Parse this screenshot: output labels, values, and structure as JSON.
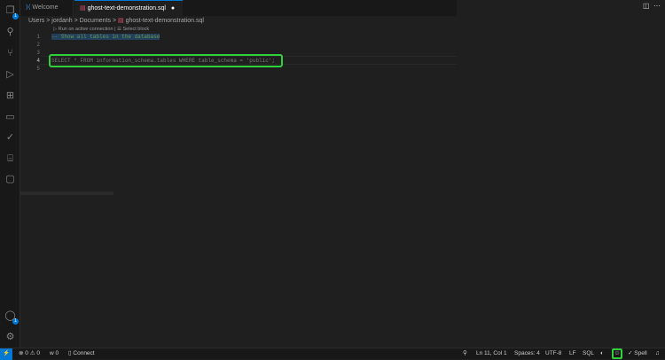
{
  "tabs": [
    {
      "label": "Welcome"
    },
    {
      "label": "ghost-text-demonstration.sql",
      "modified": "●"
    }
  ],
  "breadcrumb": [
    "Users",
    "jordanh",
    "Documents",
    "ghost-text-demonstration.sql"
  ],
  "codelens": {
    "run": "▷ Run on active connection",
    "sep": "|",
    "select": "☰ Select block"
  },
  "lines": [
    {
      "n": "1",
      "text": "-- Show all tables in the database"
    },
    {
      "n": "2",
      "text": ""
    },
    {
      "n": "3",
      "text": ""
    },
    {
      "n": "4",
      "text": "SELECT * FROM information_schema.tables WHERE table_schema = 'public';"
    },
    {
      "n": "5",
      "text": ""
    }
  ],
  "activity": {
    "explorer_badge": "1",
    "accounts_badge": "1"
  },
  "status": {
    "errors": "0",
    "warnings": "0",
    "ports": "0",
    "connect": "Connect",
    "position": "Ln 11, Col 1",
    "spaces": "Spaces: 4",
    "encoding": "UTF-8",
    "eol": "LF",
    "language": "SQL",
    "spell": "Spell"
  }
}
